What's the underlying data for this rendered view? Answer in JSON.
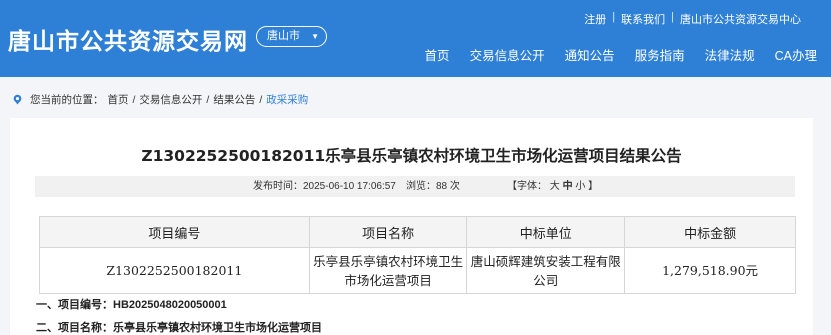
{
  "header": {
    "site_title": "唐山市公共资源交易网",
    "city_select": {
      "value": "唐山市",
      "chevron": "chevron-down-icon"
    },
    "top_links": [
      "注册",
      "联系我们",
      "唐山市公共资源交易中心"
    ],
    "top_sep": "|",
    "nav": [
      "首页",
      "交易信息公开",
      "通知公告",
      "服务指南",
      "法律法规",
      "CA办理"
    ]
  },
  "breadcrumb": {
    "prefix": "您当前的位置：",
    "items": [
      "首页",
      "交易信息公开",
      "结果公告"
    ],
    "sep": "/",
    "current": "政采采购",
    "icon": "location-pin-icon"
  },
  "article": {
    "title": "Z1302252500182011乐亭县乐亭镇农村环境卫生市场化运营项目结果公告",
    "publish": "发布时间：2025-06-10 17:06:57",
    "views": "浏览：88 次",
    "font_prefix": "【字体：",
    "font_large": "大",
    "font_medium": "中",
    "font_small": "小",
    "font_suffix": "】",
    "table": {
      "headers": [
        "项目编号",
        "项目名称",
        "中标单位",
        "中标金额"
      ],
      "rows": [
        [
          "Z1302252500182011",
          "乐亭县乐亭镇农村环境卫生市场化运营项目",
          "唐山硕辉建筑安装工程有限公司",
          "1,279,518.90元"
        ]
      ]
    },
    "section1": "一、项目编号：HB2025048020050001",
    "section2": "二、项目名称：乐亭县乐亭镇农村环境卫生市场化运营项目"
  },
  "colors": {
    "brand": "#2e7fd6"
  }
}
